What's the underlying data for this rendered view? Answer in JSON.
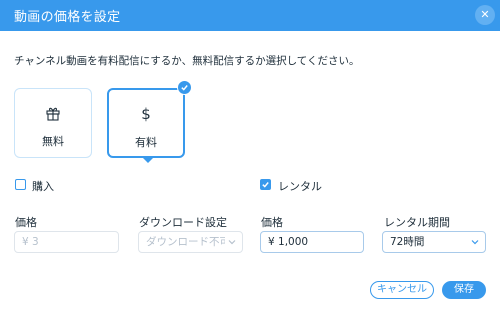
{
  "dialog": {
    "title": "動画の価格を設定",
    "description": "チャンネル動画を有料配信にするか、無料配信するか選択してください。"
  },
  "pricing_options": {
    "free_label": "無料",
    "paid_label": "有料",
    "selected": "有料"
  },
  "options": {
    "buy": {
      "label": "購入",
      "checked": false
    },
    "rental": {
      "label": "レンタル",
      "checked": true
    }
  },
  "fields": {
    "buy_price": {
      "label": "価格",
      "value": "¥ 3"
    },
    "download": {
      "label": "ダウンロード設定",
      "value": "ダウンロード不可"
    },
    "rental_price": {
      "label": "価格",
      "value": "¥ 1,000"
    },
    "rental_period": {
      "label": "レンタル期間",
      "value": "72時間"
    }
  },
  "buttons": {
    "cancel": "キャンセル",
    "save": "保存"
  },
  "colors": {
    "accent": "#3899ec",
    "header_close_bg": "#62b0f2",
    "text": "#20303c",
    "disabled_text": "#b6c1cd"
  },
  "icons": {
    "close": "close-icon",
    "free": "gift-icon",
    "paid": "dollar-icon",
    "selected": "checkmark-icon",
    "dropdown": "chevron-down-icon"
  }
}
